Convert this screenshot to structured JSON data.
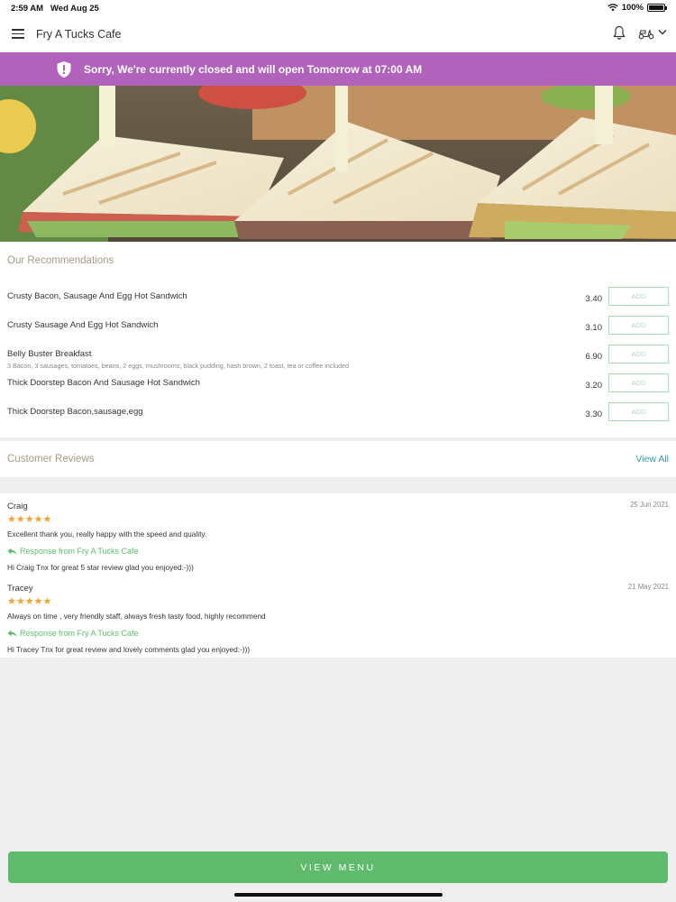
{
  "status_bar": {
    "time": "2:59 AM",
    "date": "Wed Aug 25",
    "battery": "100%"
  },
  "header": {
    "title": "Fry A Tucks Cafe"
  },
  "banner": {
    "text": "Sorry, We're currently closed and will open Tomorrow at 07:00 AM",
    "color": "#b163bc"
  },
  "recommendations": {
    "title": "Our Recommendations",
    "add_label": "ADD",
    "items": [
      {
        "name": "Crusty Bacon, Sausage And Egg Hot Sandwich",
        "description": "",
        "price": "3.40"
      },
      {
        "name": "Crusty Sausage And Egg Hot Sandwich",
        "description": "",
        "price": "3.10"
      },
      {
        "name": "Belly Buster Breakfast",
        "description": "3 Bacon, 3 sausages, tomatoes, beans, 2 eggs, mushrooms, black pudding, hash brown, 2 toast, tea or coffee included",
        "price": "6.90"
      },
      {
        "name": "Thick Doorstep Bacon And Sausage Hot Sandwich",
        "description": "",
        "price": "3.20"
      },
      {
        "name": "Thick Doorstep Bacon,sausage,egg",
        "description": "",
        "price": "3.30"
      }
    ]
  },
  "reviews": {
    "title": "Customer Reviews",
    "view_all": "View All",
    "items": [
      {
        "author": "Craig",
        "date": "25 Jun 2021",
        "rating": 5,
        "stars": "★★★★★",
        "comment": "Excellent thank you, really happy with the speed and quality.",
        "response_label": "Response from Fry A Tucks Cafe",
        "response": "Hi Craig Tnx for great 5 star review glad you enjoyed:-)))"
      },
      {
        "author": "Tracey",
        "date": "21 May 2021",
        "rating": 5,
        "stars": "★★★★★",
        "comment": "Always on time , very friendly staff, always fresh tasty food, highly recommend",
        "response_label": "Response from Fry A Tucks Cafe",
        "response": "Hi Tracey Tnx for great review and lovely comments glad you enjoyed:-)))"
      }
    ]
  },
  "footer": {
    "view_menu": "VIEW MENU",
    "button_color": "#5fbb6b"
  }
}
